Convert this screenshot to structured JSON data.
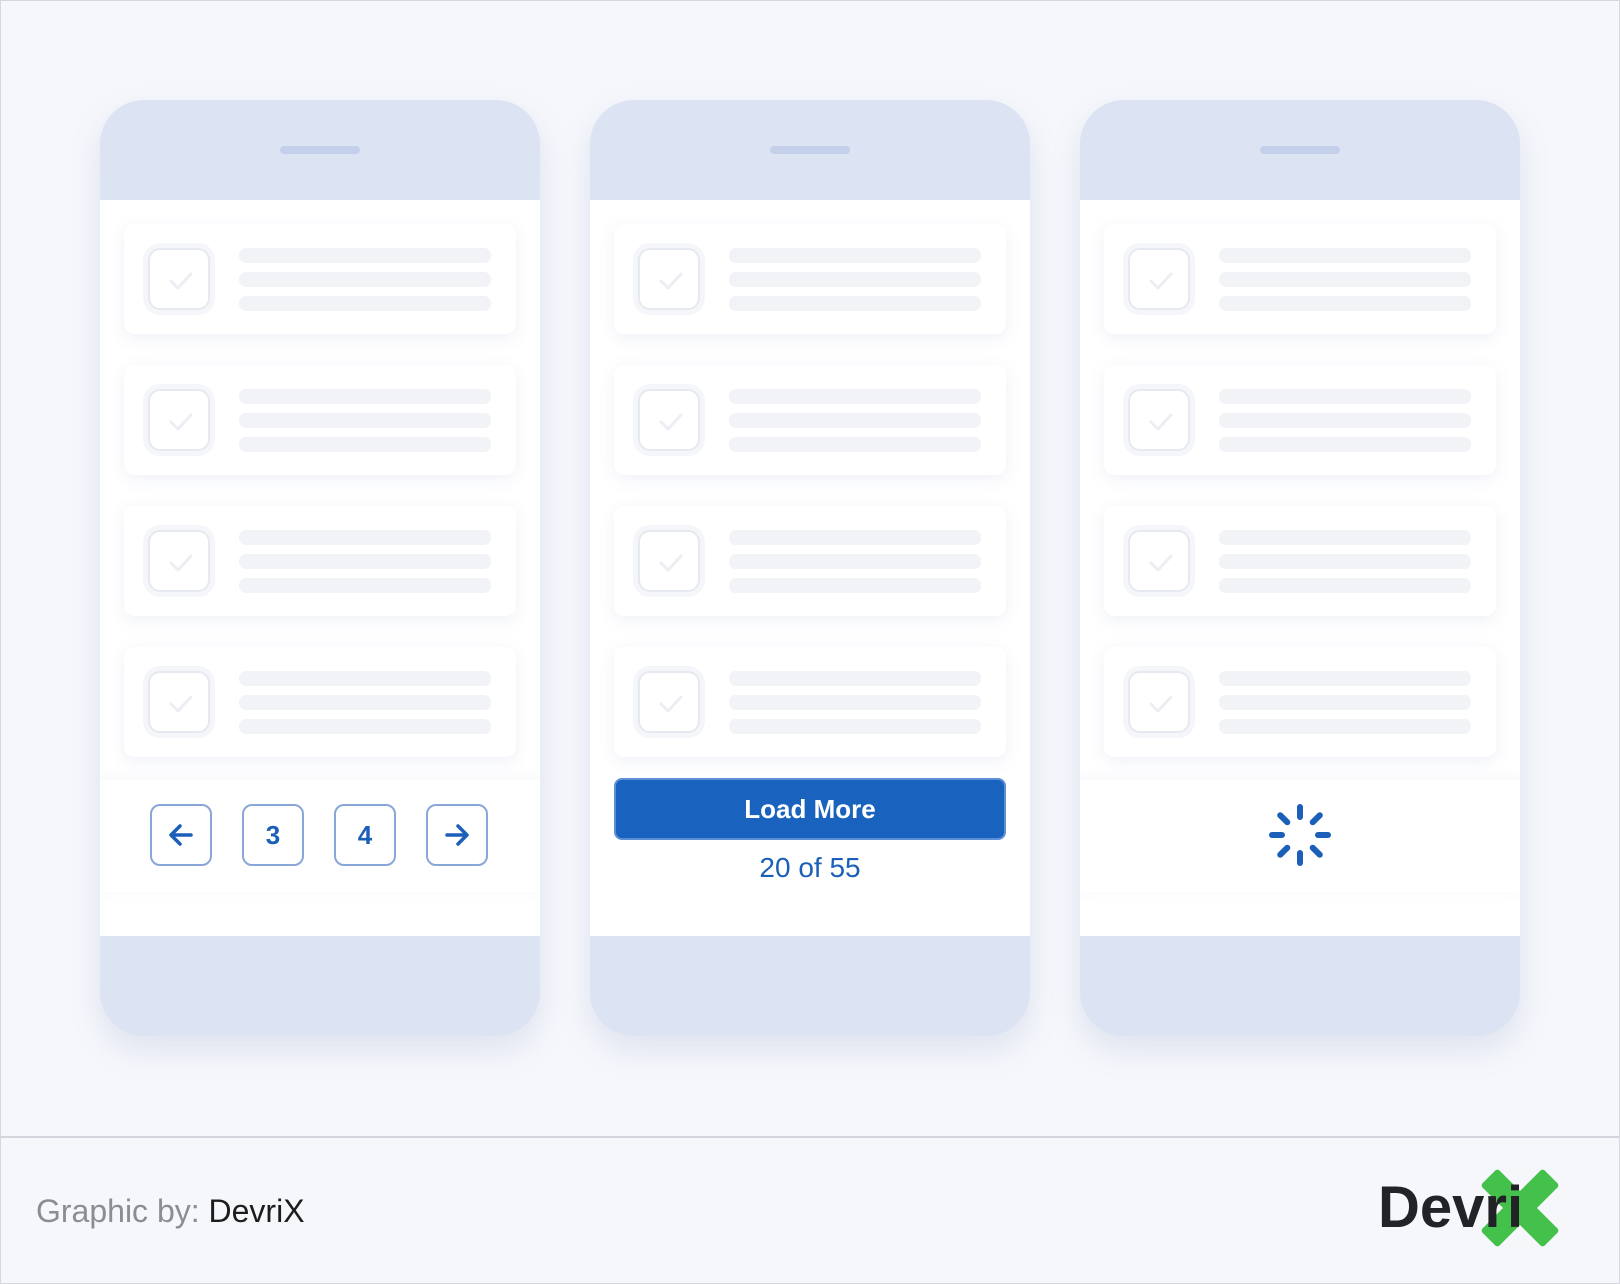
{
  "pagination_phone": {
    "prev_icon": "arrow-left-icon",
    "pages": [
      "3",
      "4"
    ],
    "next_icon": "arrow-right-icon"
  },
  "load_more_phone": {
    "button_label": "Load More",
    "count_text": "20 of 55"
  },
  "infinite_scroll_phone": {
    "spinner_icon": "loading-spinner-icon"
  },
  "footer": {
    "credit_prefix": "Graphic by:",
    "credit_brand": "DevriX",
    "logo_text": "Devri"
  },
  "colors": {
    "accent_blue": "#1962bd",
    "phone_frame": "#dce3f3",
    "logo_green": "#44c14a",
    "page_bg": "#f5f7fb"
  }
}
